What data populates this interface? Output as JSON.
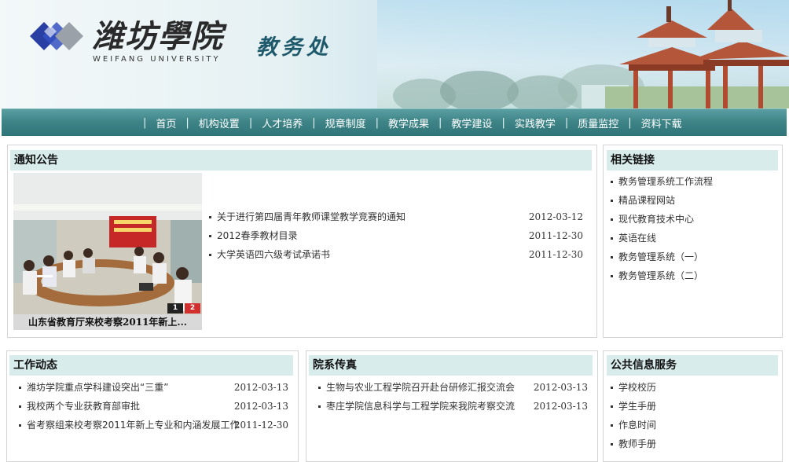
{
  "header": {
    "logo_cn": "潍坊學院",
    "logo_en": "WEIFANG UNIVERSITY",
    "department": "教务处"
  },
  "nav": {
    "items": [
      "首页",
      "机构设置",
      "人才培养",
      "规章制度",
      "教学成果",
      "教学建设",
      "实践教学",
      "质量监控",
      "资料下载"
    ]
  },
  "notice": {
    "title": "通知公告",
    "photo_caption": "山东省教育厅来校考察2011年新上...",
    "slides": [
      "1",
      "2"
    ],
    "items": [
      {
        "text": "关于进行第四届青年教师课堂教学竞赛的通知",
        "date": "2012-03-12"
      },
      {
        "text": "2012春季教材目录",
        "date": "2011-12-30"
      },
      {
        "text": "大学英语四六级考试承诺书",
        "date": "2011-12-30"
      }
    ]
  },
  "links": {
    "title": "相关链接",
    "items": [
      "教务管理系统工作流程",
      "精品课程网站",
      "现代教育技术中心",
      "英语在线",
      "教务管理系统（一）",
      "教务管理系统（二）"
    ]
  },
  "work": {
    "title": "工作动态",
    "items": [
      {
        "text": "潍坊学院重点学科建设突出“三重”",
        "date": "2012-03-13"
      },
      {
        "text": "我校两个专业获教育部审批",
        "date": "2012-03-13"
      },
      {
        "text": "省考察组来校考察2011年新上专业和内涵发展工作",
        "date": "2011-12-30"
      }
    ]
  },
  "depts": {
    "title": "院系传真",
    "items": [
      {
        "text": "生物与农业工程学院召开赴台研修汇报交流会",
        "date": "2012-03-13"
      },
      {
        "text": "枣庄学院信息科学与工程学院来我院考察交流",
        "date": "2012-03-13"
      }
    ]
  },
  "public": {
    "title": "公共信息服务",
    "items": [
      "学校校历",
      "学生手册",
      "作息时间",
      "教师手册"
    ]
  },
  "colors": {
    "nav_bg": "#3f8588",
    "title_bg": "#d8ecec",
    "dept_text": "#1f5a6c"
  }
}
